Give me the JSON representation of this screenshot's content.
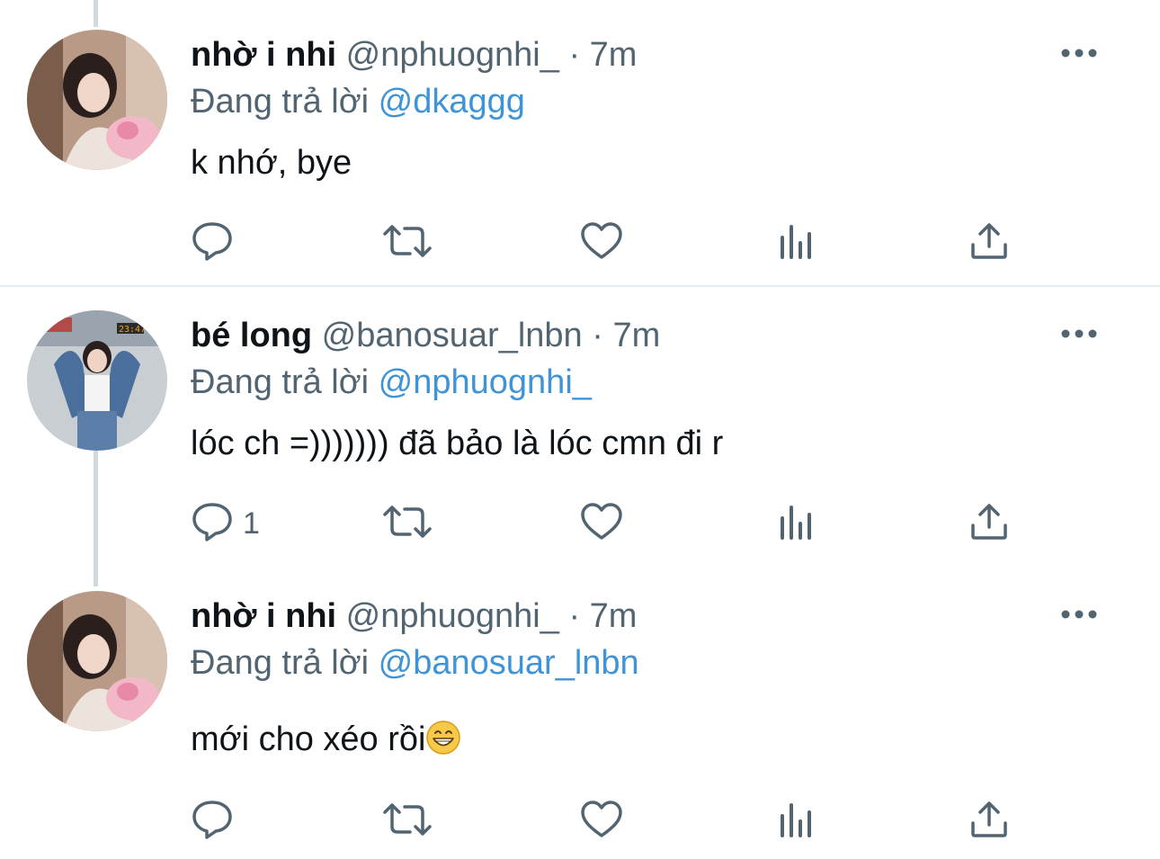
{
  "tweets": [
    {
      "display_name": "nhờ i nhi",
      "handle": "@nphuognhi_",
      "dot": "·",
      "time": "7m",
      "reply_prefix": "Đang trả lời",
      "reply_to": "@dkaggg",
      "text": "k nhớ, bye",
      "reply_count": ""
    },
    {
      "display_name": "bé long",
      "handle": "@banosuar_lnbn",
      "dot": "·",
      "time": "7m",
      "reply_prefix": "Đang trả lời",
      "reply_to": "@nphuognhi_",
      "text": "lóc ch =))))))) đã bảo là lóc cmn đi r",
      "reply_count": "1"
    },
    {
      "display_name": "nhờ i nhi",
      "handle": "@nphuognhi_",
      "dot": "·",
      "time": "7m",
      "reply_prefix": "Đang trả lời",
      "reply_to": "@banosuar_lnbn",
      "text": "mới cho xéo rồi",
      "reply_count": ""
    }
  ],
  "icons": {
    "more": "more-horizontal-icon",
    "reply": "reply-bubble-icon",
    "retweet": "retweet-icon",
    "like": "heart-icon",
    "views": "analytics-bars-icon",
    "share": "share-upload-icon",
    "emoji": "grinning-face-emoji"
  },
  "colors": {
    "text": "#0f1419",
    "secondary": "#536471",
    "mention": "#3f94d8",
    "thread_line": "#cfd9de",
    "divider": "#e6ecf0"
  }
}
